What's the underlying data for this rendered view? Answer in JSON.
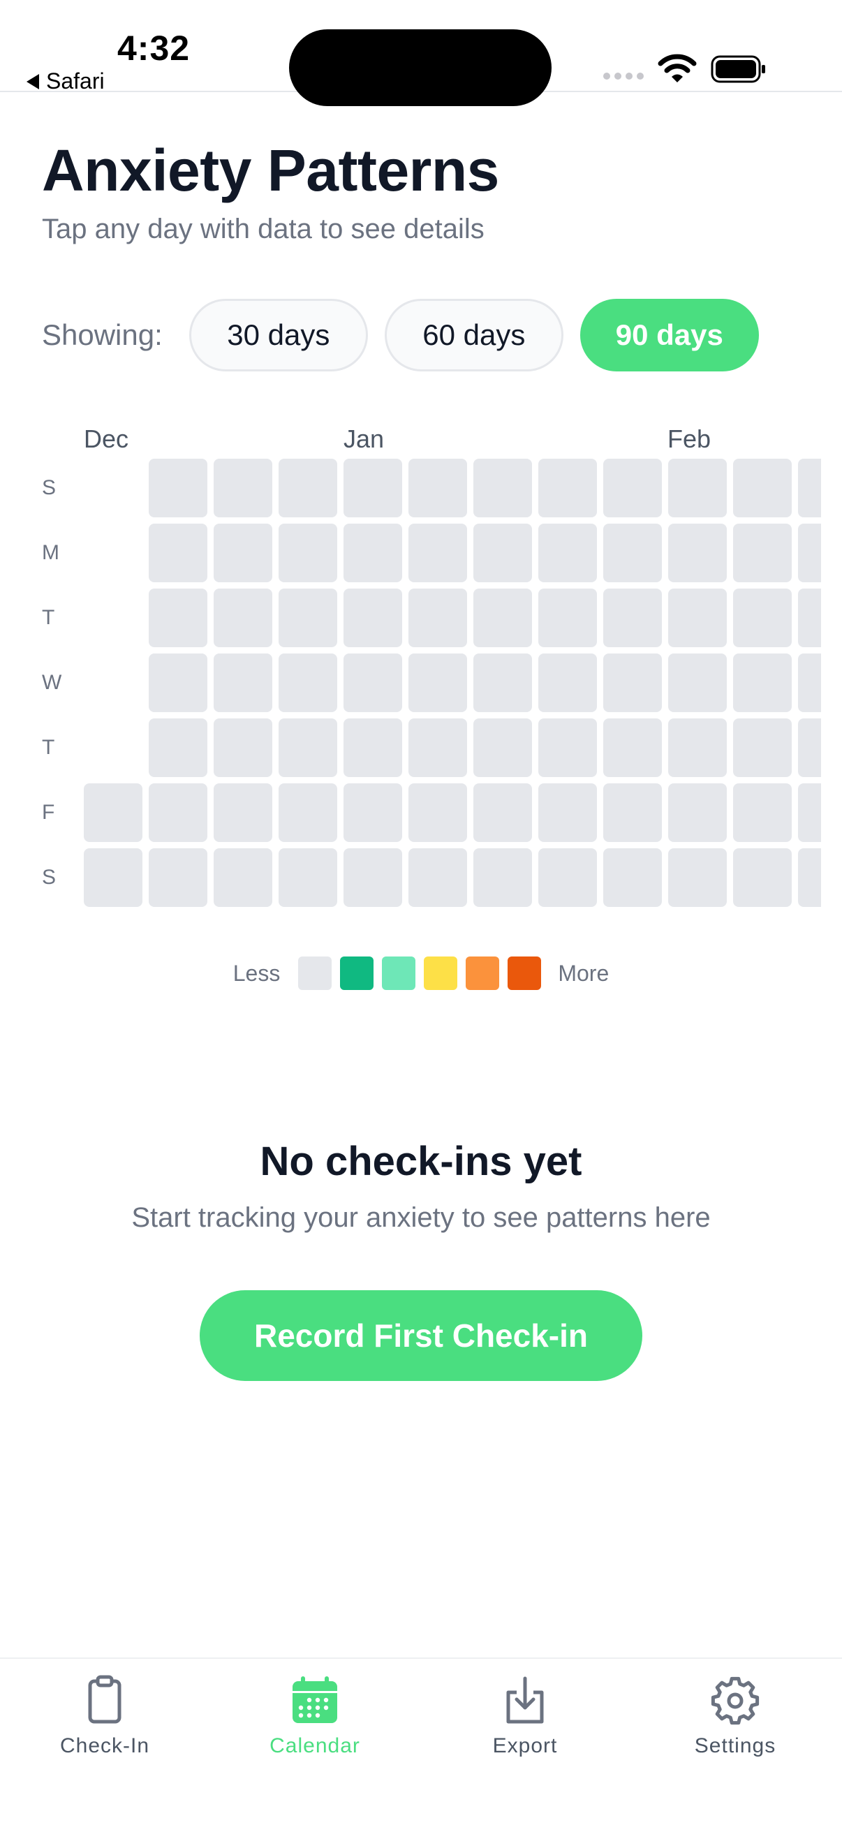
{
  "status_bar": {
    "time": "4:32",
    "back_app": "Safari"
  },
  "header": {
    "title": "Anxiety Patterns",
    "subtitle": "Tap any day with data to see details"
  },
  "range": {
    "label": "Showing:",
    "options": [
      "30 days",
      "60 days",
      "90 days"
    ],
    "selected": "90 days"
  },
  "heatmap": {
    "months": [
      "Dec",
      "Jan",
      "Feb"
    ],
    "day_labels": [
      "S",
      "M",
      "T",
      "W",
      "T",
      "F",
      "S"
    ],
    "empty_color": "#e5e7eb"
  },
  "legend": {
    "less": "Less",
    "more": "More",
    "colors": [
      "#e5e7eb",
      "#10b981",
      "#6ee7b7",
      "#fde047",
      "#fb923c",
      "#ea580c"
    ]
  },
  "empty_state": {
    "title": "No check-ins yet",
    "subtitle": "Start tracking your anxiety to see patterns here",
    "button": "Record First Check-in"
  },
  "tabs": [
    {
      "label": "Check-In",
      "icon": "clipboard-icon",
      "active": false
    },
    {
      "label": "Calendar",
      "icon": "calendar-icon",
      "active": true
    },
    {
      "label": "Export",
      "icon": "download-icon",
      "active": false
    },
    {
      "label": "Settings",
      "icon": "gear-icon",
      "active": false
    }
  ],
  "colors": {
    "accent": "#4ade80",
    "text": "#111827",
    "muted": "#6b7280"
  }
}
